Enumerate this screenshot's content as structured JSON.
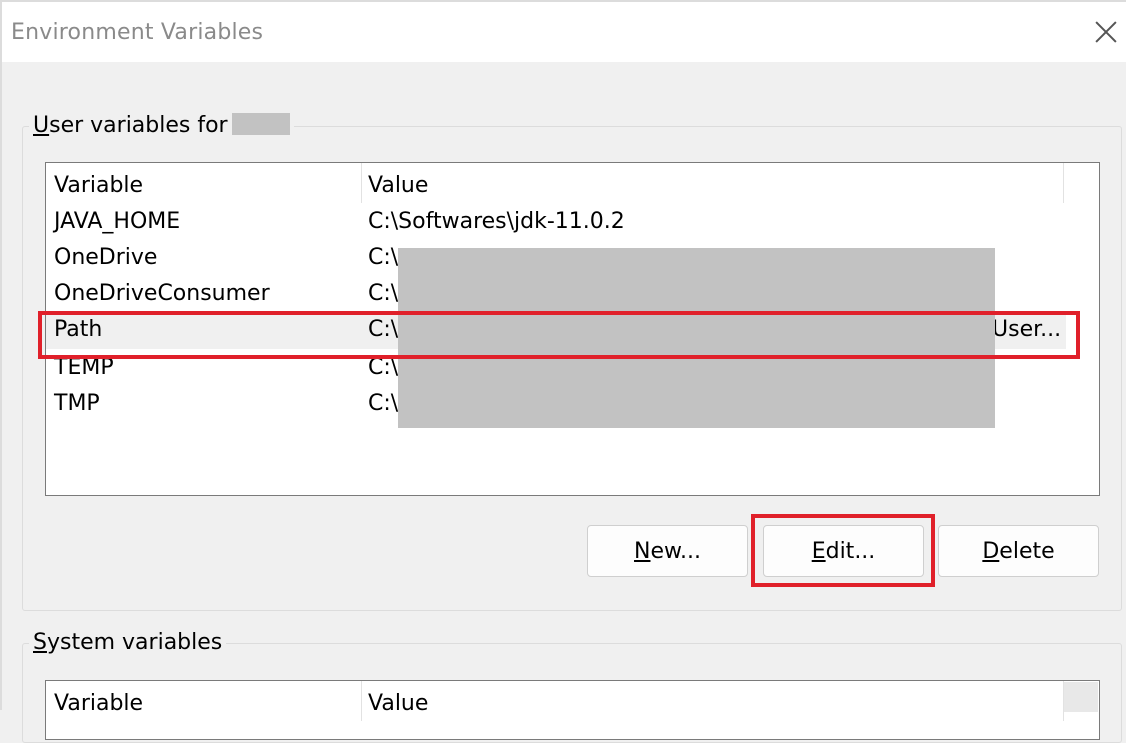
{
  "window": {
    "title": "Environment Variables"
  },
  "user_group": {
    "label_prefix": "U",
    "label_rest": "ser variables for",
    "columns": {
      "variable": "Variable",
      "value": "Value"
    },
    "rows": [
      {
        "name": "JAVA_HOME",
        "value": "C:\\Softwares\\jdk-11.0.2"
      },
      {
        "name": "OneDrive",
        "value": "C:\\"
      },
      {
        "name": "OneDriveConsumer",
        "value": "C:\\"
      },
      {
        "name": "Path",
        "value": "C:\\",
        "value_tail": "User..."
      },
      {
        "name": "TEMP",
        "value": "C:\\"
      },
      {
        "name": "TMP",
        "value": "C:\\"
      }
    ],
    "selected_row": "Path",
    "buttons": {
      "new": {
        "accel": "N",
        "rest": "ew..."
      },
      "edit": {
        "accel": "E",
        "rest": "dit..."
      },
      "delete": {
        "accel": "D",
        "rest": "elete"
      }
    }
  },
  "system_group": {
    "label_prefix": "S",
    "label_rest": "ystem variables",
    "columns": {
      "variable": "Variable",
      "value": "Value"
    }
  },
  "colors": {
    "highlight": "#e0202a",
    "redaction": "#c2c2c2"
  },
  "icons": {
    "close": "close-icon"
  }
}
